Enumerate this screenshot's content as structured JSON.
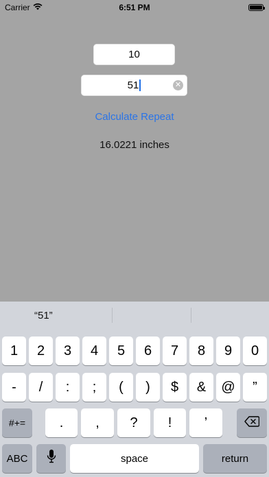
{
  "status_bar": {
    "carrier": "Carrier",
    "time": "6:51 PM"
  },
  "form": {
    "field1_value": "10",
    "field2_value": "51",
    "calculate_label": "Calculate Repeat",
    "result_text": "16.0221 inches"
  },
  "keyboard": {
    "suggestion": "“51”",
    "row1": [
      "1",
      "2",
      "3",
      "4",
      "5",
      "6",
      "7",
      "8",
      "9",
      "0"
    ],
    "row2": [
      "-",
      "/",
      ":",
      ";",
      "(",
      ")",
      "$",
      "&",
      "@",
      "”"
    ],
    "row3_mode": "#+=",
    "row3": [
      ".",
      ",",
      "?",
      "!",
      "’"
    ],
    "abc_label": "ABC",
    "space_label": "space",
    "return_label": "return"
  }
}
